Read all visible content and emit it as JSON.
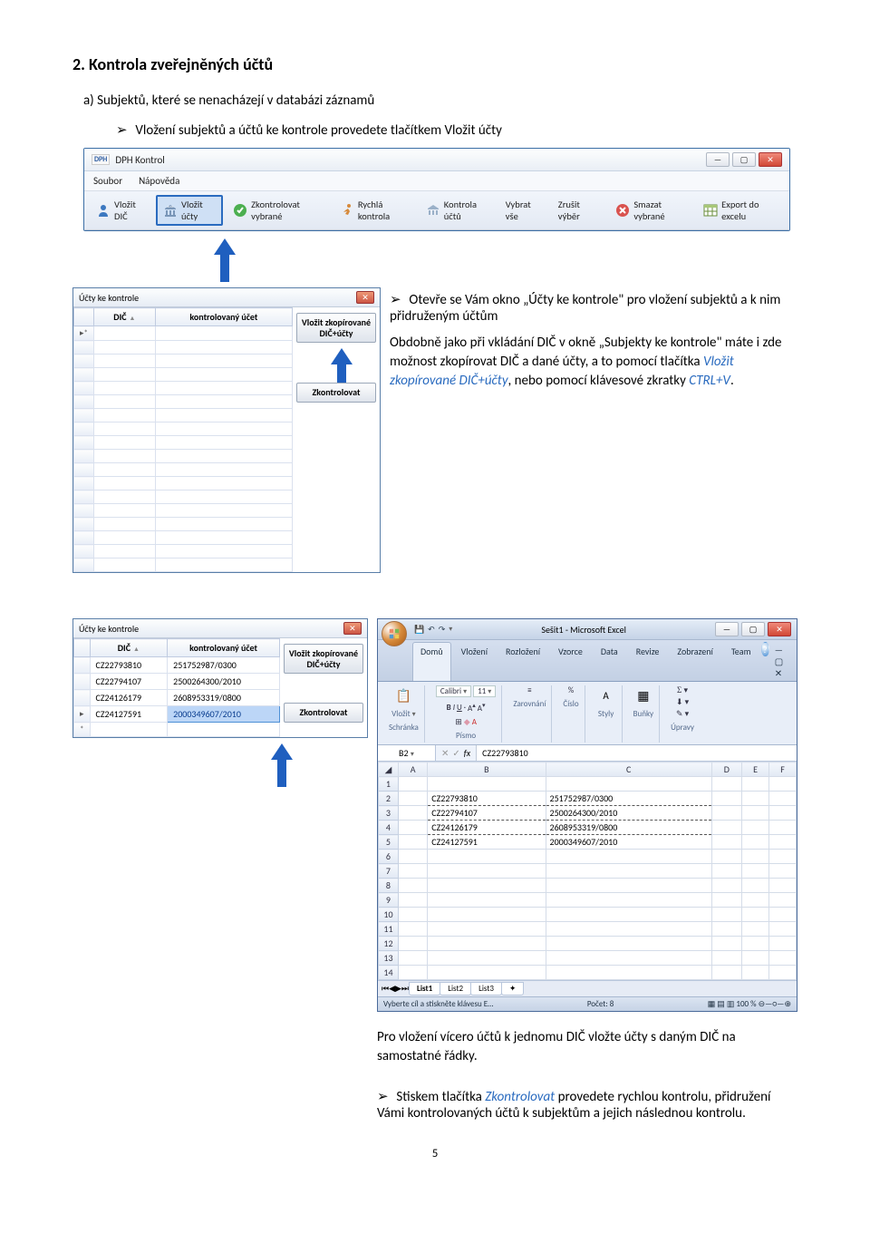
{
  "heading": "2. Kontrola zveřejněných účtů",
  "list_a": "a)  Subjektů, které se nenacházejí v databázi záznamů",
  "bullet1": "Vložení subjektů a účtů ke kontrole provedete tlačítkem Vložit účty",
  "bullet2": "Otevře se Vám okno „Účty ke kontrole\" pro vložení subjektů a k nim přidruženým účtům",
  "para1a": "Obdobně jako při vkládání DIČ v okně „Subjekty ke kontrole\" máte i zde možnost zkopírovat DIČ a dané účty, a to pomocí tlačítka ",
  "para1b": "Vložit zkopírované DIČ+účty",
  "para1c": ", nebo pomocí klávesové zkratky ",
  "para1d": "CTRL+V",
  "para1e": ".",
  "para2": "Pro vložení vícero účtů k jednomu DIČ vložte účty s daným DIČ na samostatné řádky.",
  "bullet3a": "Stiskem tlačítka ",
  "bullet3b": "Zkontrolovat",
  "bullet3c": " provedete rychlou kontrolu, přidružení Vámi kontrolovaných účtů k subjektům a jejich následnou kontrolu.",
  "mainwin": {
    "app": "DPH",
    "title": "DPH Kontrol",
    "menu": {
      "soubor": "Soubor",
      "napoveda": "Nápověda"
    },
    "toolbar": {
      "vlozit_dic": "Vložit DIČ",
      "vlozit_ucty": "Vložit účty",
      "zkontrolovat_vybrane": "Zkontrolovat vybrané",
      "rychla_kontrola": "Rychlá kontrola",
      "kontrola_uctu": "Kontrola účtů",
      "vybrat_vse": "Vybrat vše",
      "zrusit_vyber": "Zrušit výběr",
      "smazat_vybrane": "Smazat vybrané",
      "export": "Export do excelu"
    }
  },
  "sw1": {
    "title": "Účty ke kontrole",
    "col_dic": "DIČ",
    "col_ucet": "kontrolovaný účet",
    "pointer": "▸*",
    "btn_vlozit": "Vložit zkopírované DIČ+účty",
    "btn_zk": "Zkontrolovat"
  },
  "sw2": {
    "title": "Účty ke kontrole",
    "col_dic": "DIČ",
    "col_ucet": "kontrolovaný účet",
    "rows": [
      {
        "dic": "CZ22793810",
        "ucet": "251752987/0300"
      },
      {
        "dic": "CZ22794107",
        "ucet": "2500264300/2010"
      },
      {
        "dic": "CZ24126179",
        "ucet": "2608953319/0800"
      },
      {
        "dic": "CZ24127591",
        "ucet": "2000349607/2010"
      }
    ],
    "btn_vlozit": "Vložit zkopírované DIČ+účty",
    "btn_zk": "Zkontrolovat"
  },
  "excel": {
    "title": "Sešit1 - Microsoft Excel",
    "tabs": {
      "domu": "Domů",
      "vlozeni": "Vložení",
      "rozlozeni": "Rozložení",
      "vzorce": "Vzorce",
      "data": "Data",
      "revize": "Revize",
      "zobrazeni": "Zobrazení",
      "team": "Team"
    },
    "groups": {
      "schranka": "Schránka",
      "pismo": "Písmo",
      "zarovnani": "Zarovnání",
      "cislo": "Číslo",
      "styly": "Styly",
      "bunky": "Buňky",
      "upravy": "Úpravy",
      "vlozit": "Vložit"
    },
    "font": "Calibri",
    "size": "11",
    "namebox": "B2",
    "fx": "fx",
    "fxval": "CZ22793810",
    "cols": [
      "A",
      "B",
      "C",
      "D",
      "E",
      "F"
    ],
    "rows": [
      [
        "",
        "",
        "",
        "",
        "",
        ""
      ],
      [
        "",
        "CZ22793810",
        "251752987/0300",
        "",
        "",
        ""
      ],
      [
        "",
        "CZ22794107",
        "2500264300/2010",
        "",
        "",
        ""
      ],
      [
        "",
        "CZ24126179",
        "2608953319/0800",
        "",
        "",
        ""
      ],
      [
        "",
        "CZ24127591",
        "2000349607/2010",
        "",
        "",
        ""
      ],
      [
        "",
        "",
        "",
        "",
        "",
        ""
      ],
      [
        "",
        "",
        "",
        "",
        "",
        ""
      ],
      [
        "",
        "",
        "",
        "",
        "",
        ""
      ],
      [
        "",
        "",
        "",
        "",
        "",
        ""
      ],
      [
        "",
        "",
        "",
        "",
        "",
        ""
      ],
      [
        "",
        "",
        "",
        "",
        "",
        ""
      ],
      [
        "",
        "",
        "",
        "",
        "",
        ""
      ],
      [
        "",
        "",
        "",
        "",
        "",
        ""
      ],
      [
        "",
        "",
        "",
        "",
        "",
        ""
      ]
    ],
    "sheets": {
      "l1": "List1",
      "l2": "List2",
      "l3": "List3"
    },
    "status_left": "Vyberte cíl a stiskněte klávesu E…",
    "status_count": "Počet: 8",
    "zoom": "100 %"
  },
  "page_num": "5"
}
